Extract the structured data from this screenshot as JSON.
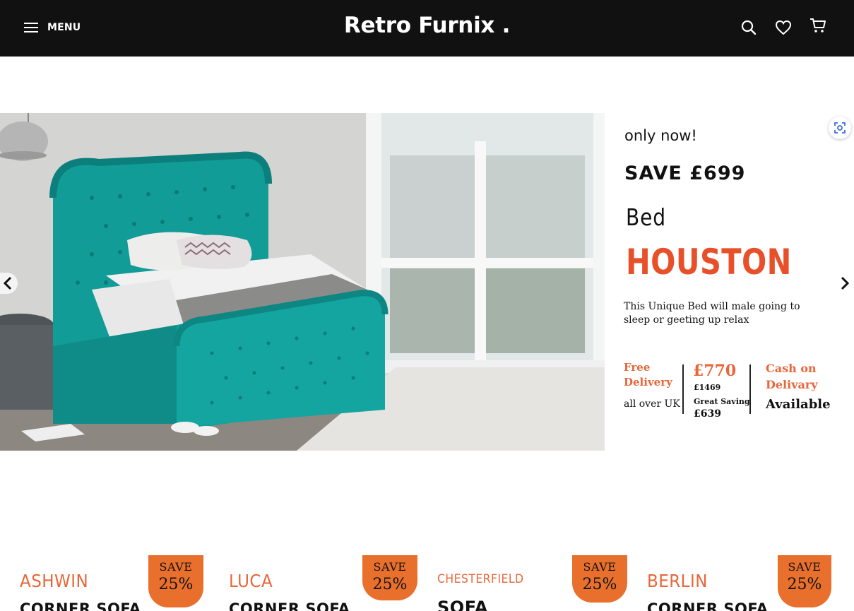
{
  "header": {
    "menu_label": "MENU",
    "logo": "Retro Furnix ."
  },
  "hero": {
    "promo": {
      "only_now": "only now!",
      "save": "SAVE £699",
      "category": "Bed",
      "name": "HOUSTON",
      "description": "This Unique Bed will male going to sleep or geeting up relax",
      "free_delivery": "Free Delivery",
      "all_over": "all over UK",
      "price": "£770",
      "was_price": "£1469",
      "great_saving_label": "Great Saving",
      "great_saving_value": "£639",
      "cash_on_delivery": "Cash on Delivary",
      "available": "Available"
    }
  },
  "banners": [
    {
      "name": "ASHWIN",
      "type": "CORNER SOFA",
      "save": "SAVE",
      "percent": "25%"
    },
    {
      "name": "LUCA",
      "type": "CORNER SOFA",
      "save": "SAVE",
      "percent": "25%"
    },
    {
      "name": "CHESTERFIELD",
      "type": "SOFA",
      "save": "SAVE",
      "percent": "25%"
    },
    {
      "name": "BERLIN",
      "type": "CORNER SOFA",
      "save": "SAVE",
      "percent": "25%"
    }
  ],
  "colors": {
    "header_bg": "#111111",
    "accent_orange": "#e8673a",
    "bed_teal": "#119c98"
  },
  "icons": [
    "menu-icon",
    "search-icon",
    "heart-icon",
    "cart-icon",
    "zoom-icon",
    "chevron-left-icon",
    "chevron-right-icon"
  ]
}
